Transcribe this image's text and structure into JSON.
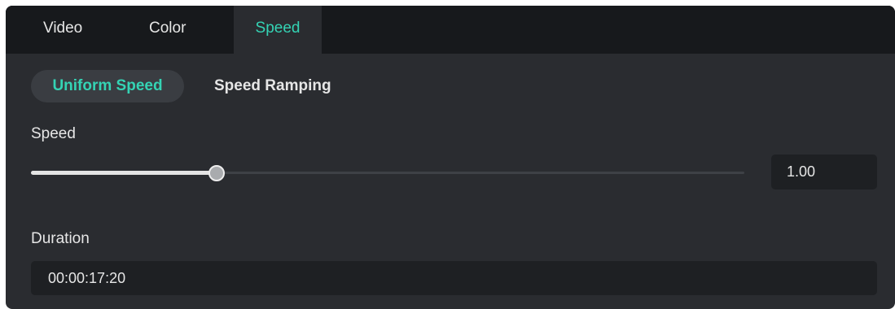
{
  "tabs": [
    {
      "label": "Video"
    },
    {
      "label": "Color"
    },
    {
      "label": "Speed"
    }
  ],
  "active_tab": "Speed",
  "subtabs": [
    {
      "label": "Uniform Speed"
    },
    {
      "label": "Speed Ramping"
    }
  ],
  "active_subtab": "Uniform Speed",
  "speed": {
    "label": "Speed",
    "value": "1.00",
    "slider_fraction": 0.26
  },
  "duration": {
    "label": "Duration",
    "value": "00:00:17:20"
  },
  "colors": {
    "accent": "#34d3b4",
    "panel_bg": "#2a2c30",
    "tabbar_bg": "#17191c",
    "field_bg": "#1e2023"
  }
}
